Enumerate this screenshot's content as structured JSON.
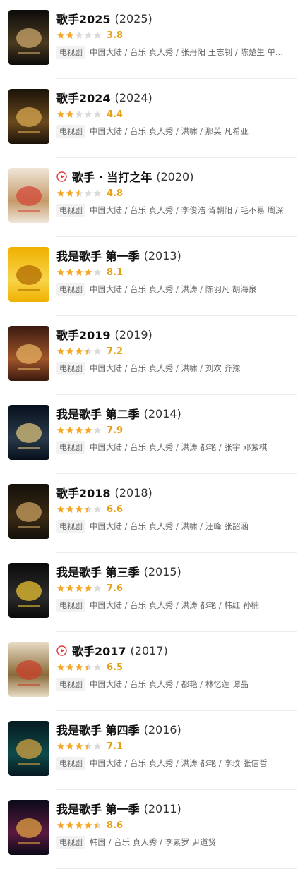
{
  "colors": {
    "star_on": "#f5a623",
    "star_off": "#d9d9d9",
    "play": "#e0353b"
  },
  "shows": [
    {
      "title": "歌手2025",
      "year": "(2025)",
      "rating": 3.8,
      "score": "3.8",
      "tag": "电视剧",
      "meta": "中国大陆 / 音乐 真人秀 / 张丹阳 王志钊 / 陈楚生 单...",
      "playable": false,
      "poster": [
        "#0c0b0a",
        "#4a3a20",
        "#c9a66b"
      ]
    },
    {
      "title": "歌手2024",
      "year": "(2024)",
      "rating": 4.4,
      "score": "4.4",
      "tag": "电视剧",
      "meta": "中国大陆 / 音乐 真人秀 / 洪啸 / 那英 凡希亚",
      "playable": false,
      "poster": [
        "#1a1208",
        "#6b4a1e",
        "#d8a850"
      ]
    },
    {
      "title": "歌手 · 当打之年",
      "year": "(2020)",
      "rating": 4.8,
      "score": "4.8",
      "tag": "电视剧",
      "meta": "中国大陆 / 音乐 真人秀 / 李俊浩 胥朝阳 / 毛不易 周深",
      "playable": true,
      "poster": [
        "#efe6d8",
        "#c59a6a",
        "#d34a3a"
      ]
    },
    {
      "title": "我是歌手 第一季",
      "year": "(2013)",
      "rating": 8.1,
      "score": "8.1",
      "tag": "电视剧",
      "meta": "中国大陆 / 音乐 真人秀 / 洪涛 / 陈羽凡 胡海泉",
      "playable": false,
      "poster": [
        "#f0b000",
        "#f7d54a",
        "#b06a00"
      ]
    },
    {
      "title": "歌手2019",
      "year": "(2019)",
      "rating": 7.2,
      "score": "7.2",
      "tag": "电视剧",
      "meta": "中国大陆 / 音乐 真人秀 / 洪啸 / 刘欢 齐豫",
      "playable": false,
      "poster": [
        "#3a1a10",
        "#a0552a",
        "#e6b060"
      ]
    },
    {
      "title": "我是歌手 第二季",
      "year": "(2014)",
      "rating": 7.9,
      "score": "7.9",
      "tag": "电视剧",
      "meta": "中国大陆 / 音乐 真人秀 / 洪涛 都艳 / 张宇 邓紫棋",
      "playable": false,
      "poster": [
        "#06101c",
        "#2a3a4a",
        "#d9c07a"
      ]
    },
    {
      "title": "歌手2018",
      "year": "(2018)",
      "rating": 6.6,
      "score": "6.6",
      "tag": "电视剧",
      "meta": "中国大陆 / 音乐 真人秀 / 洪啸 / 汪峰 张韶涵",
      "playable": false,
      "poster": [
        "#14100a",
        "#3a2a14",
        "#c9a060"
      ]
    },
    {
      "title": "我是歌手 第三季",
      "year": "(2015)",
      "rating": 7.6,
      "score": "7.6",
      "tag": "电视剧",
      "meta": "中国大陆 / 音乐 真人秀 / 洪涛 都艳 / 韩红 孙楠",
      "playable": false,
      "poster": [
        "#0a0a0a",
        "#2c2c2c",
        "#e8c030"
      ]
    },
    {
      "title": "歌手2017",
      "year": "(2017)",
      "rating": 6.5,
      "score": "6.5",
      "tag": "电视剧",
      "meta": "中国大陆 / 音乐 真人秀 / 都艳 / 林忆莲 谭晶",
      "playable": true,
      "poster": [
        "#e8dcc4",
        "#8a6a3a",
        "#c8402a"
      ]
    },
    {
      "title": "我是歌手 第四季",
      "year": "(2016)",
      "rating": 7.1,
      "score": "7.1",
      "tag": "电视剧",
      "meta": "中国大陆 / 音乐 真人秀 / 洪涛 都艳 / 李玟 张信哲",
      "playable": false,
      "poster": [
        "#061a20",
        "#0e4a4a",
        "#d4a040"
      ]
    },
    {
      "title": "我是歌手 第一季",
      "year": "(2011)",
      "rating": 8.6,
      "score": "8.6",
      "tag": "电视剧",
      "meta": "韩国 / 音乐 真人秀 / 李素罗 尹道贤",
      "playable": false,
      "poster": [
        "#0a0a18",
        "#5a1a40",
        "#e0a040"
      ]
    }
  ]
}
